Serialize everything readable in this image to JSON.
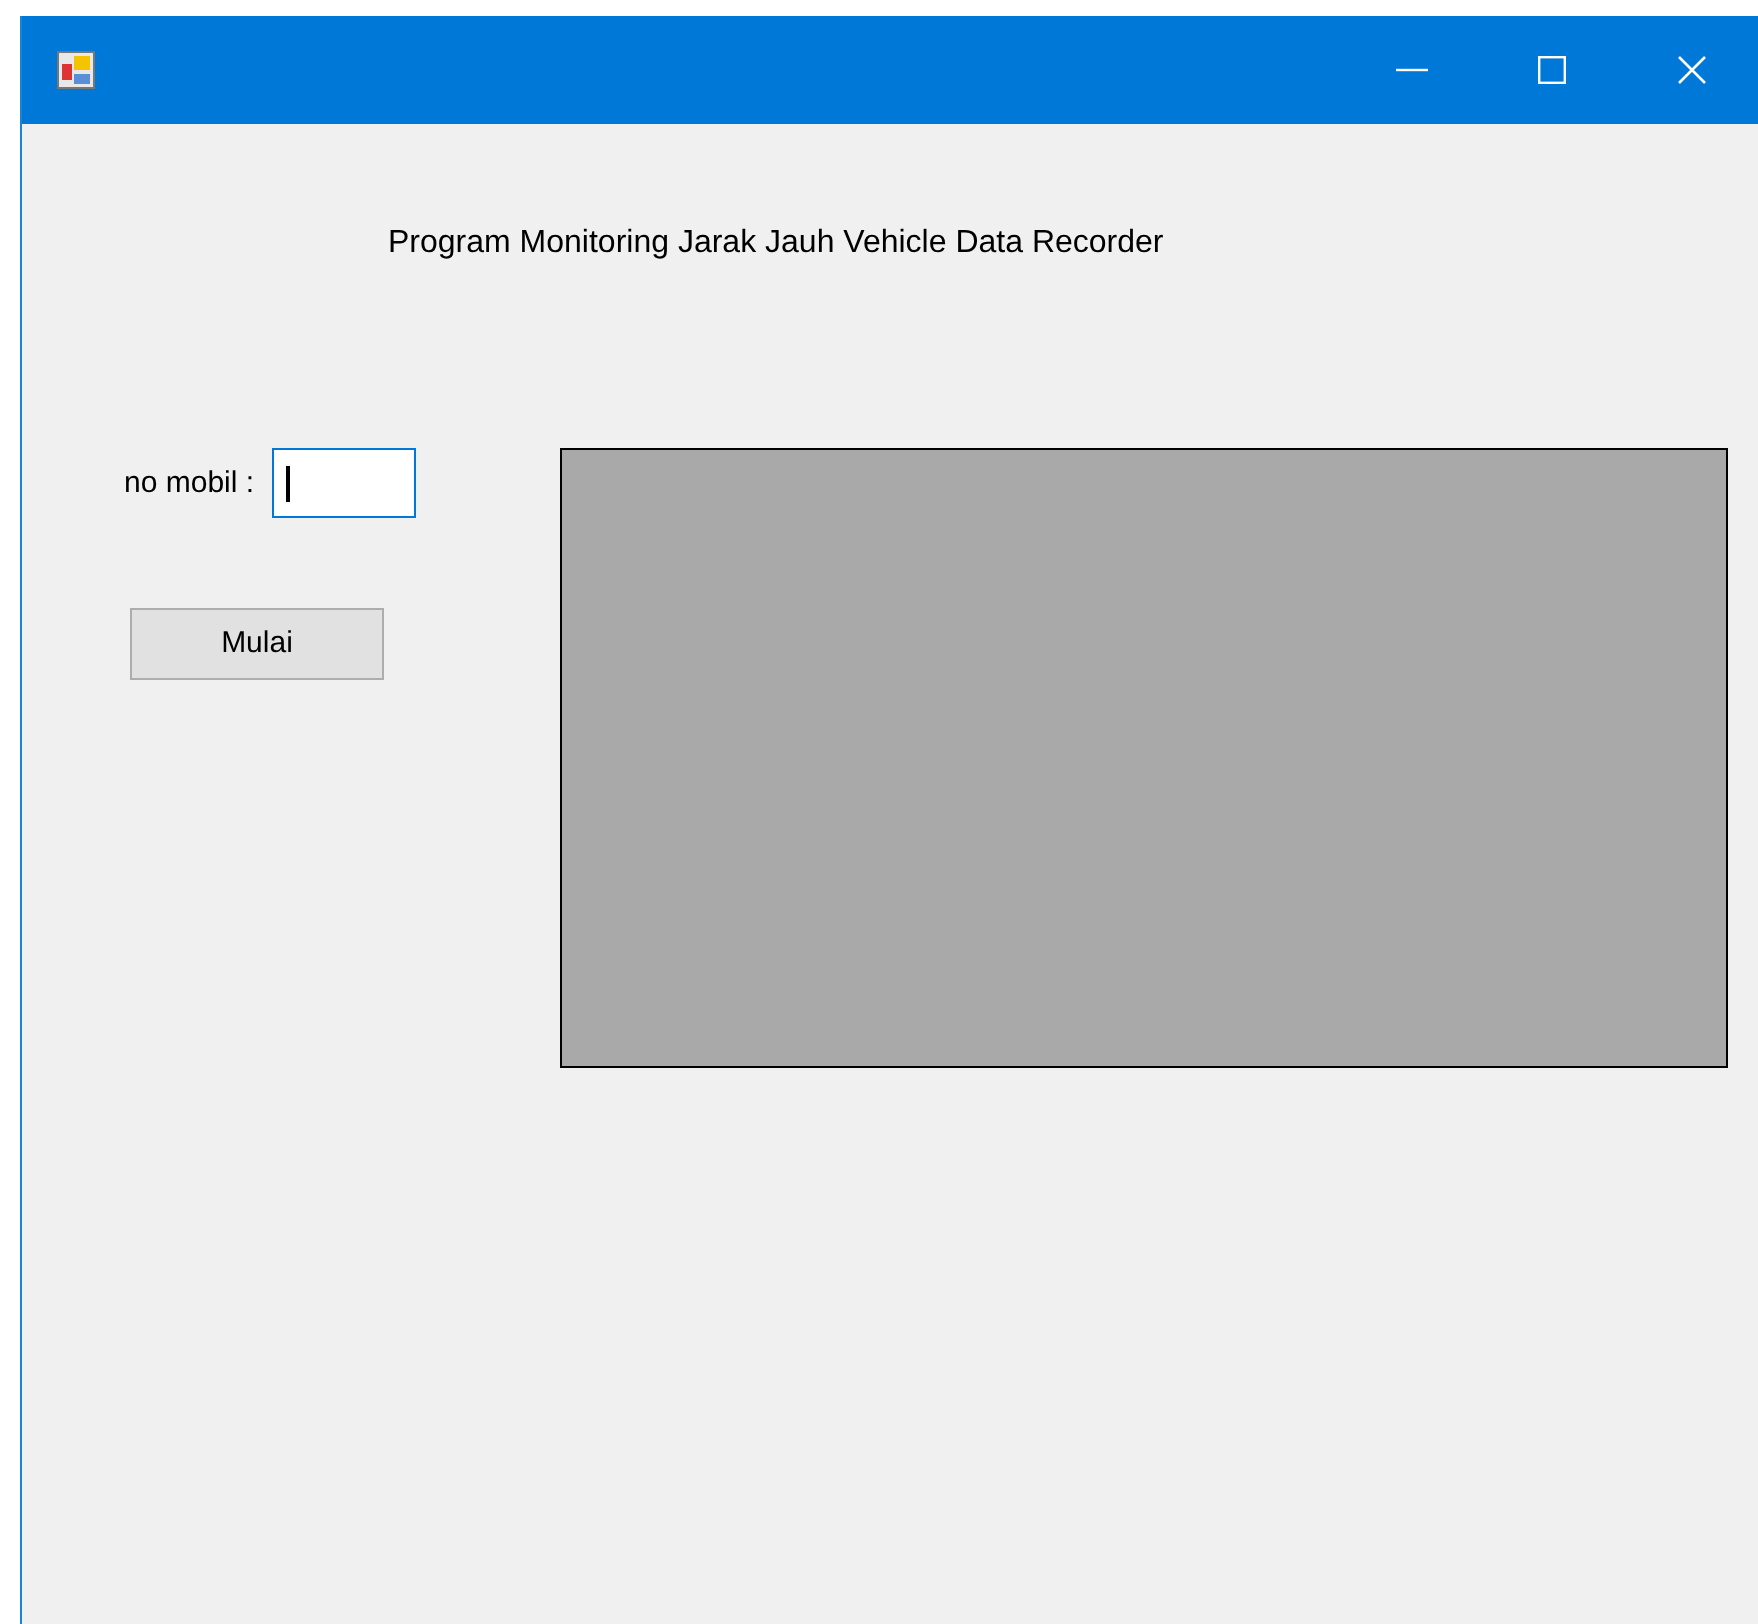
{
  "window": {
    "title_bar": {
      "buttons": [
        {
          "kind": "minimize"
        },
        {
          "kind": "maximize"
        },
        {
          "kind": "close"
        }
      ]
    }
  },
  "heading": "Program Monitoring Jarak Jauh Vehicle Data Recorder",
  "form": {
    "label": "no mobil :",
    "field": {
      "focused": true
    },
    "button": "Mulai"
  },
  "panel": {
    "kind": "empty"
  }
}
